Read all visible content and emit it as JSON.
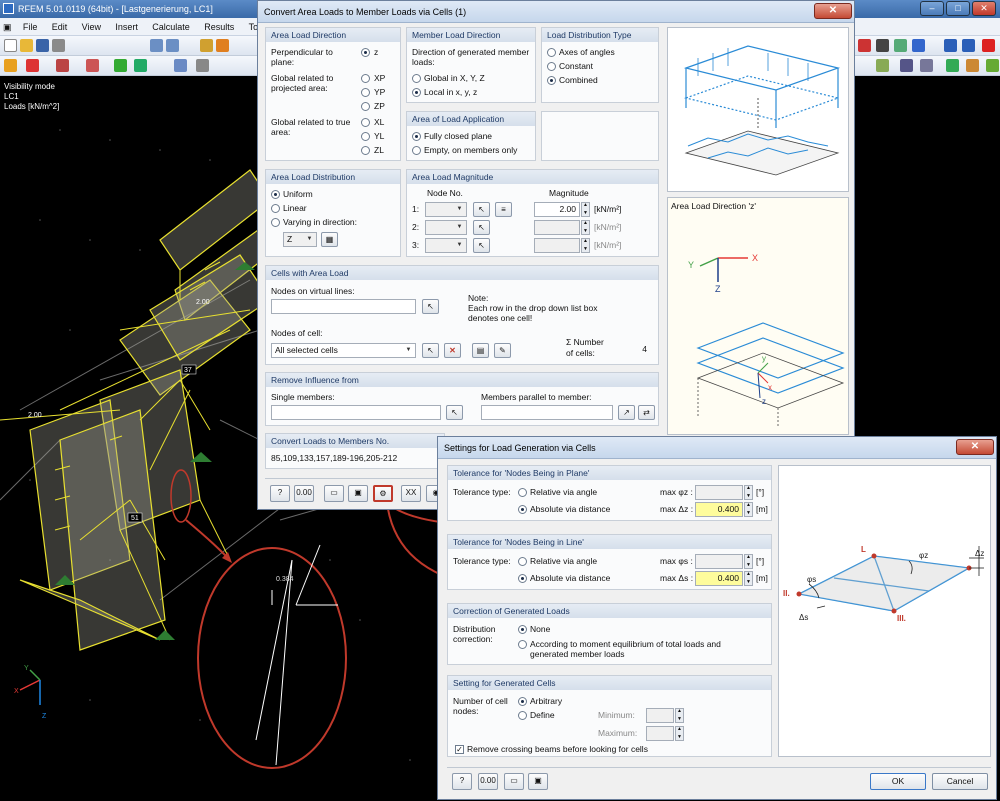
{
  "app": {
    "title": "RFEM 5.01.0119 (64bit) - [Lastgenerierung, LC1]",
    "menu": [
      "File",
      "Edit",
      "View",
      "Insert",
      "Calculate",
      "Results",
      "Tools"
    ],
    "viewport_info": [
      "Visibility mode",
      "LC1",
      "Loads [kN/m^2]"
    ],
    "labels": {
      "load_a": "2.00",
      "load_b": "2.00",
      "node_37": "37",
      "node_51": "51",
      "zoom_value": "0.384"
    },
    "axes": {
      "x": "X",
      "y": "Y",
      "z": "Z"
    }
  },
  "convert_dialog": {
    "title": "Convert Area Loads to Member Loads via Cells  (1)",
    "close_label": "x",
    "area_load_direction": {
      "header": "Area Load Direction",
      "perp_label": "Perpendicular to plane:",
      "global_proj_label": "Global related to projected area:",
      "global_true_label": "Global related to true area:",
      "options": [
        "z",
        "XP",
        "YP",
        "ZP",
        "XL",
        "YL",
        "ZL"
      ],
      "selected": "z"
    },
    "member_load_direction": {
      "header": "Member Load Direction",
      "desc": "Direction of generated member loads:",
      "options": [
        "Global in X, Y, Z",
        "Local in x, y, z"
      ],
      "selected": "Local in x, y, z"
    },
    "load_distribution_type": {
      "header": "Load Distribution Type",
      "options": [
        "Axes of angles",
        "Constant",
        "Combined"
      ],
      "selected": "Combined"
    },
    "area_of_load_application": {
      "header": "Area of Load Application",
      "options": [
        "Fully closed plane",
        "Empty, on members only"
      ],
      "selected": "Fully closed plane"
    },
    "area_load_distribution": {
      "header": "Area Load Distribution",
      "options": [
        "Uniform",
        "Linear",
        "Varying in direction:"
      ],
      "selected": "Uniform",
      "direction_value": "Z"
    },
    "area_load_magnitude": {
      "header": "Area Load Magnitude",
      "col_node": "Node No.",
      "col_magnitude": "Magnitude",
      "rows": [
        {
          "label": "1:",
          "magnitude": "2.00",
          "unit": "[kN/m²]"
        },
        {
          "label": "2:",
          "magnitude": "",
          "unit": "[kN/m²]"
        },
        {
          "label": "3:",
          "magnitude": "",
          "unit": "[kN/m²]"
        }
      ]
    },
    "cells_with_area_load": {
      "header": "Cells with Area Load",
      "nodes_virtual_label": "Nodes on virtual lines:",
      "note": [
        "Note:",
        "Each row in the drop down list box",
        "denotes one cell!"
      ],
      "nodes_cell_label": "Nodes of cell:",
      "nodes_cell_value": "All selected cells",
      "number_label": [
        "Σ Number",
        "of cells:"
      ],
      "number_value": "4"
    },
    "remove_influence": {
      "header": "Remove Influence from",
      "single_label": "Single members:",
      "parallel_label": "Members parallel to member:"
    },
    "convert_to": {
      "header": "Convert Loads to Members No.",
      "value": "85,109,133,157,189-196,205-212"
    },
    "preview_caption": "Area Load Direction 'z'",
    "preview_axes": {
      "x": "X",
      "y": "Y",
      "z": "Z",
      "ly": "y",
      "lx": "x",
      "lz": "z"
    }
  },
  "settings_dialog": {
    "title": "Settings for Load Generation via Cells",
    "close_label": "x",
    "tol_plane": {
      "header": "Tolerance for 'Nodes Being in Plane'",
      "type_label": "Tolerance type:",
      "options": [
        "Relative via angle",
        "Absolute via distance"
      ],
      "selected": "Absolute via distance",
      "max_angle_label": "max φz :",
      "max_dist_label": "max Δz :",
      "angle_unit": "[°]",
      "dist_value": "0.400",
      "dist_unit": "[m]"
    },
    "tol_line": {
      "header": "Tolerance for 'Nodes Being in Line'",
      "type_label": "Tolerance type:",
      "options": [
        "Relative via angle",
        "Absolute via distance"
      ],
      "selected": "Absolute via distance",
      "max_angle_label": "max φs :",
      "max_dist_label": "max Δs :",
      "angle_unit": "[°]",
      "dist_value": "0.400",
      "dist_unit": "[m]"
    },
    "correction": {
      "header": "Correction of Generated Loads",
      "label": "Distribution correction:",
      "options": [
        "None",
        "According to moment equilibrium of total loads and generated member loads"
      ],
      "selected": "None"
    },
    "generated_cells": {
      "header": "Setting for Generated Cells",
      "label": "Number of cell nodes:",
      "options": [
        "Arbitrary",
        "Define"
      ],
      "selected": "Arbitrary",
      "min_label": "Minimum:",
      "max_label": "Maximum:",
      "remove_crossing": "Remove crossing beams before looking for cells",
      "remove_crossing_checked": true
    },
    "diagram_labels": {
      "L": "L",
      "II": "II.",
      "III": "III.",
      "phi_z": "φz",
      "phi_s": "φs",
      "delta_z": "Δz",
      "delta_s": "Δs"
    },
    "ok_label": "OK",
    "cancel_label": "Cancel"
  }
}
